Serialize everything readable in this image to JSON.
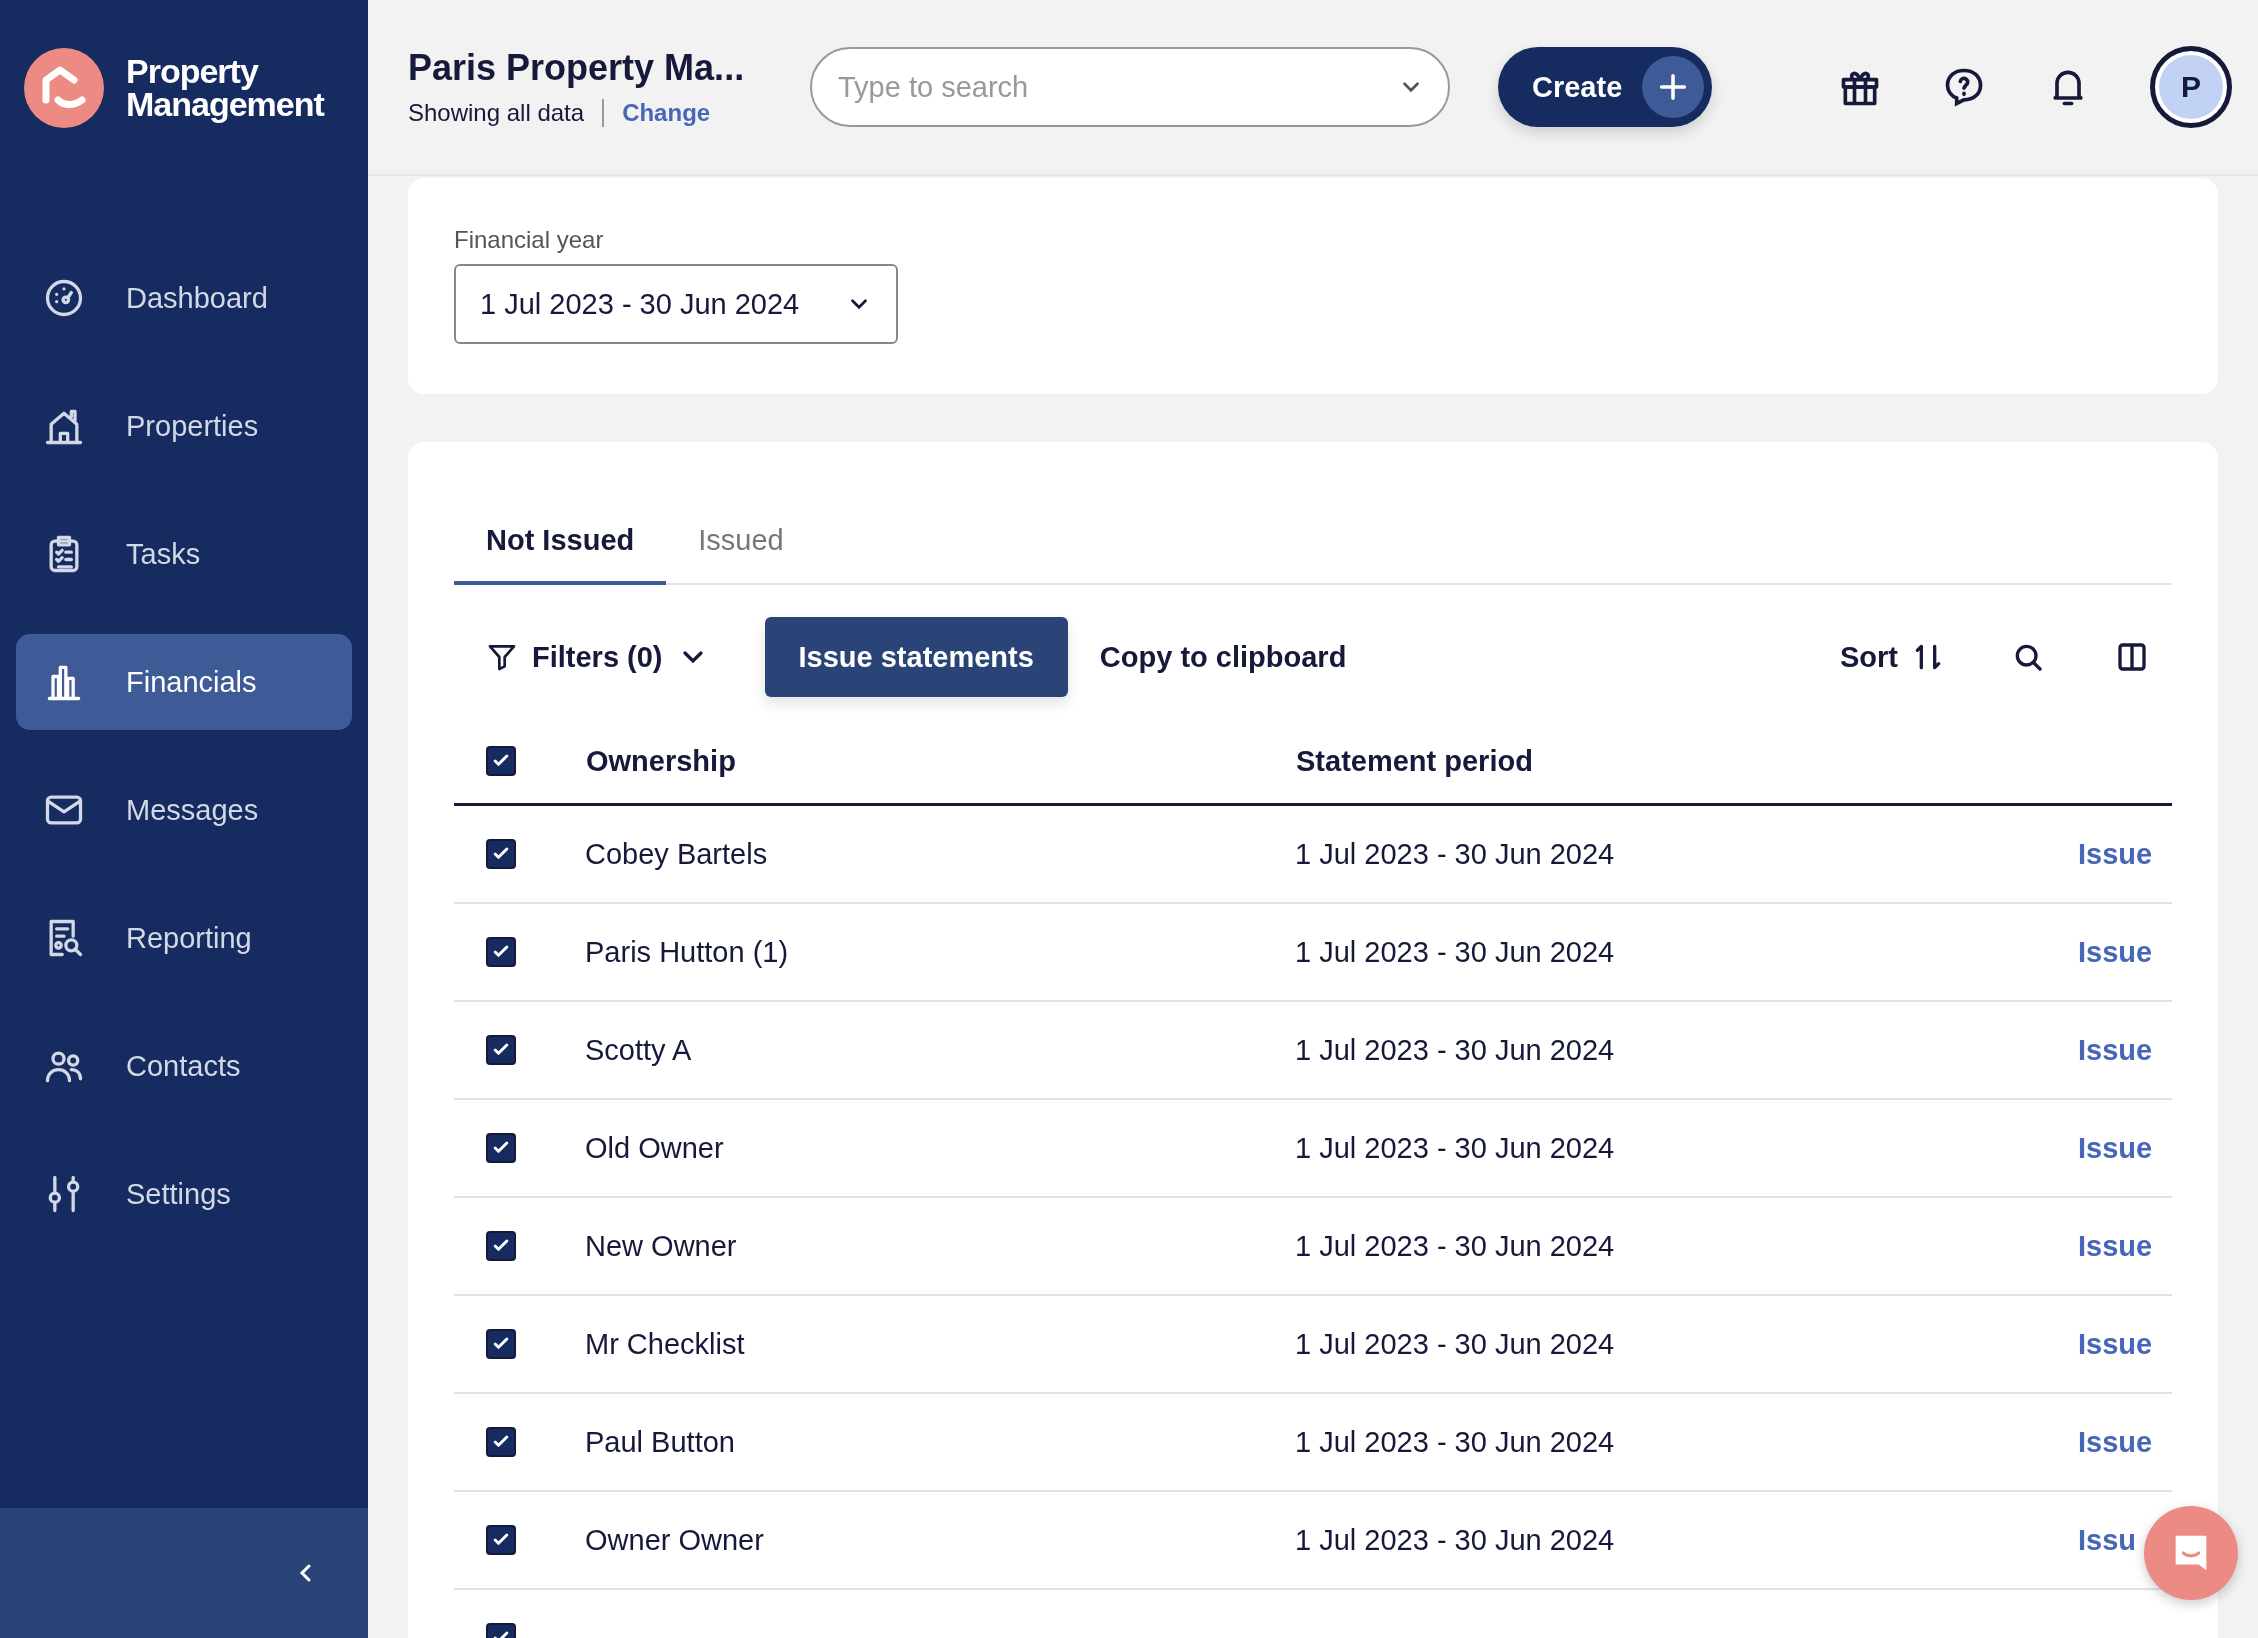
{
  "brand": {
    "name_line1": "Property",
    "name_line2": "Management"
  },
  "nav": [
    {
      "label": "Dashboard",
      "selected": false
    },
    {
      "label": "Properties",
      "selected": false
    },
    {
      "label": "Tasks",
      "selected": false
    },
    {
      "label": "Financials",
      "selected": true
    },
    {
      "label": "Messages",
      "selected": false
    },
    {
      "label": "Reporting",
      "selected": false
    },
    {
      "label": "Contacts",
      "selected": false
    },
    {
      "label": "Settings",
      "selected": false
    }
  ],
  "header": {
    "account": "Paris Property Ma...",
    "scope": "Showing all data",
    "change": "Change",
    "search": {
      "placeholder": "Type to search"
    },
    "create": "Create",
    "avatar": "P"
  },
  "filter": {
    "label": "Financial year",
    "value": "1 Jul 2023 - 30 Jun 2024"
  },
  "tabs": [
    {
      "label": "Not Issued",
      "selected": true
    },
    {
      "label": "Issued",
      "selected": false
    }
  ],
  "toolbar": {
    "filters": "Filters (0)",
    "issue": "Issue statements",
    "copy": "Copy to clipboard",
    "sort": "Sort"
  },
  "table": {
    "all_checked": true,
    "columns": [
      "Ownership",
      "Statement period"
    ],
    "rows": [
      {
        "checked": true,
        "ownership": "Cobey Bartels",
        "period": "1 Jul 2023 - 30 Jun 2024",
        "action": "Issue"
      },
      {
        "checked": true,
        "ownership": "Paris Hutton (1)",
        "period": "1 Jul 2023 - 30 Jun 2024",
        "action": "Issue"
      },
      {
        "checked": true,
        "ownership": "Scotty A",
        "period": "1 Jul 2023 - 30 Jun 2024",
        "action": "Issue"
      },
      {
        "checked": true,
        "ownership": "Old Owner",
        "period": "1 Jul 2023 - 30 Jun 2024",
        "action": "Issue"
      },
      {
        "checked": true,
        "ownership": "New Owner",
        "period": "1 Jul 2023 - 30 Jun 2024",
        "action": "Issue"
      },
      {
        "checked": true,
        "ownership": "Mr Checklist",
        "period": "1 Jul 2023 - 30 Jun 2024",
        "action": "Issue"
      },
      {
        "checked": true,
        "ownership": "Paul Button",
        "period": "1 Jul 2023 - 30 Jun 2024",
        "action": "Issue"
      },
      {
        "checked": true,
        "ownership": "Owner Owner",
        "period": "1 Jul 2023 - 30 Jun 2024",
        "action": "Issu"
      },
      {
        "checked": true
      }
    ]
  }
}
